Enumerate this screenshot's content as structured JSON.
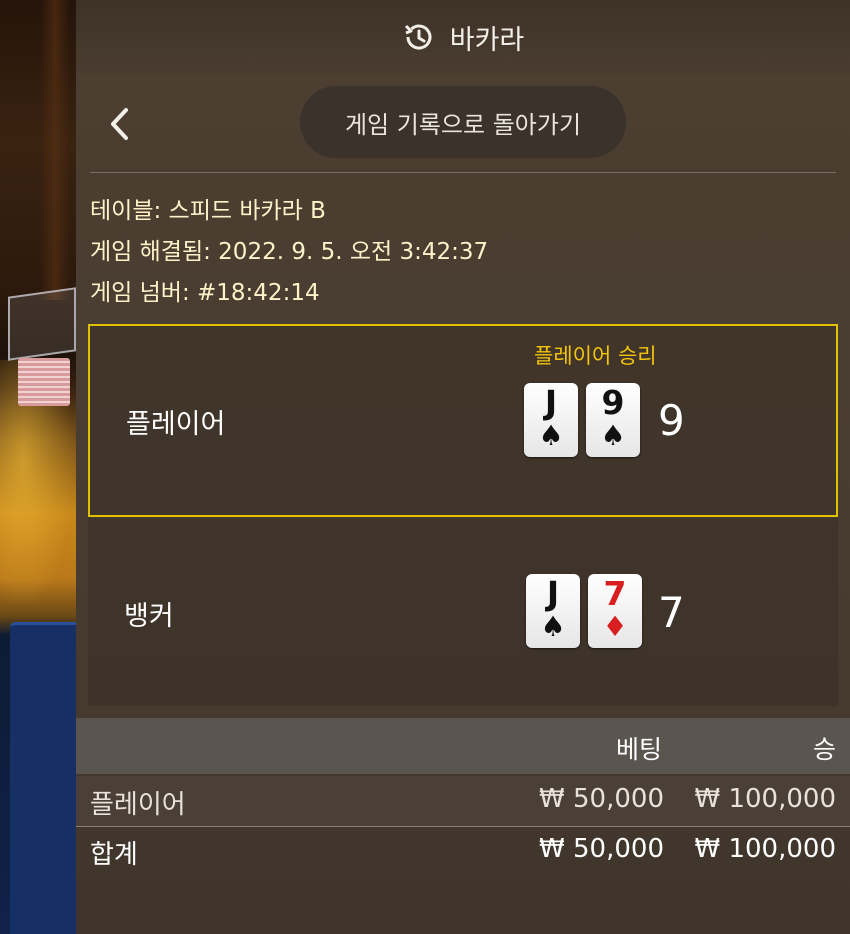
{
  "header": {
    "title": "바카라",
    "icon": "history-icon"
  },
  "nav": {
    "back_icon": "chevron-left-icon",
    "back_history_label": "게임 기록으로 돌아가기"
  },
  "info": {
    "table": "테이블: 스피드 바카라 B",
    "resolved": "게임 해결됨: 2022. 9. 5. 오전 3:42:37",
    "number": "게임 넘버: #18:42:14"
  },
  "player": {
    "label": "플레이어",
    "result": "플레이어 승리",
    "cards": [
      {
        "rank": "J",
        "suit": "♠",
        "color": "black"
      },
      {
        "rank": "9",
        "suit": "♠",
        "color": "black"
      }
    ],
    "score": "9"
  },
  "banker": {
    "label": "뱅커",
    "cards": [
      {
        "rank": "J",
        "suit": "♠",
        "color": "black"
      },
      {
        "rank": "7",
        "suit": "♦",
        "color": "red"
      }
    ],
    "score": "7"
  },
  "bets": {
    "headers": {
      "bet": "베팅",
      "win": "승"
    },
    "rows": [
      {
        "label": "플레이어",
        "bet": "₩ 50,000",
        "win": "₩ 100,000"
      },
      {
        "label": "합계",
        "bet": "₩ 50,000",
        "win": "₩ 100,000"
      }
    ]
  },
  "colors": {
    "win_border": "#e1c000",
    "win_text": "#f2c40c",
    "info_text": "#fff2c8"
  }
}
